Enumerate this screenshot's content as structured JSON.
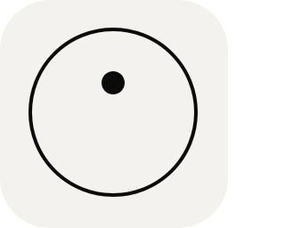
{
  "icon": {
    "name": "circle-with-dot-icon",
    "background_color": "#f3f2ee",
    "stroke_color": "#0b0b0b",
    "dot_color": "#0b0b0b"
  }
}
